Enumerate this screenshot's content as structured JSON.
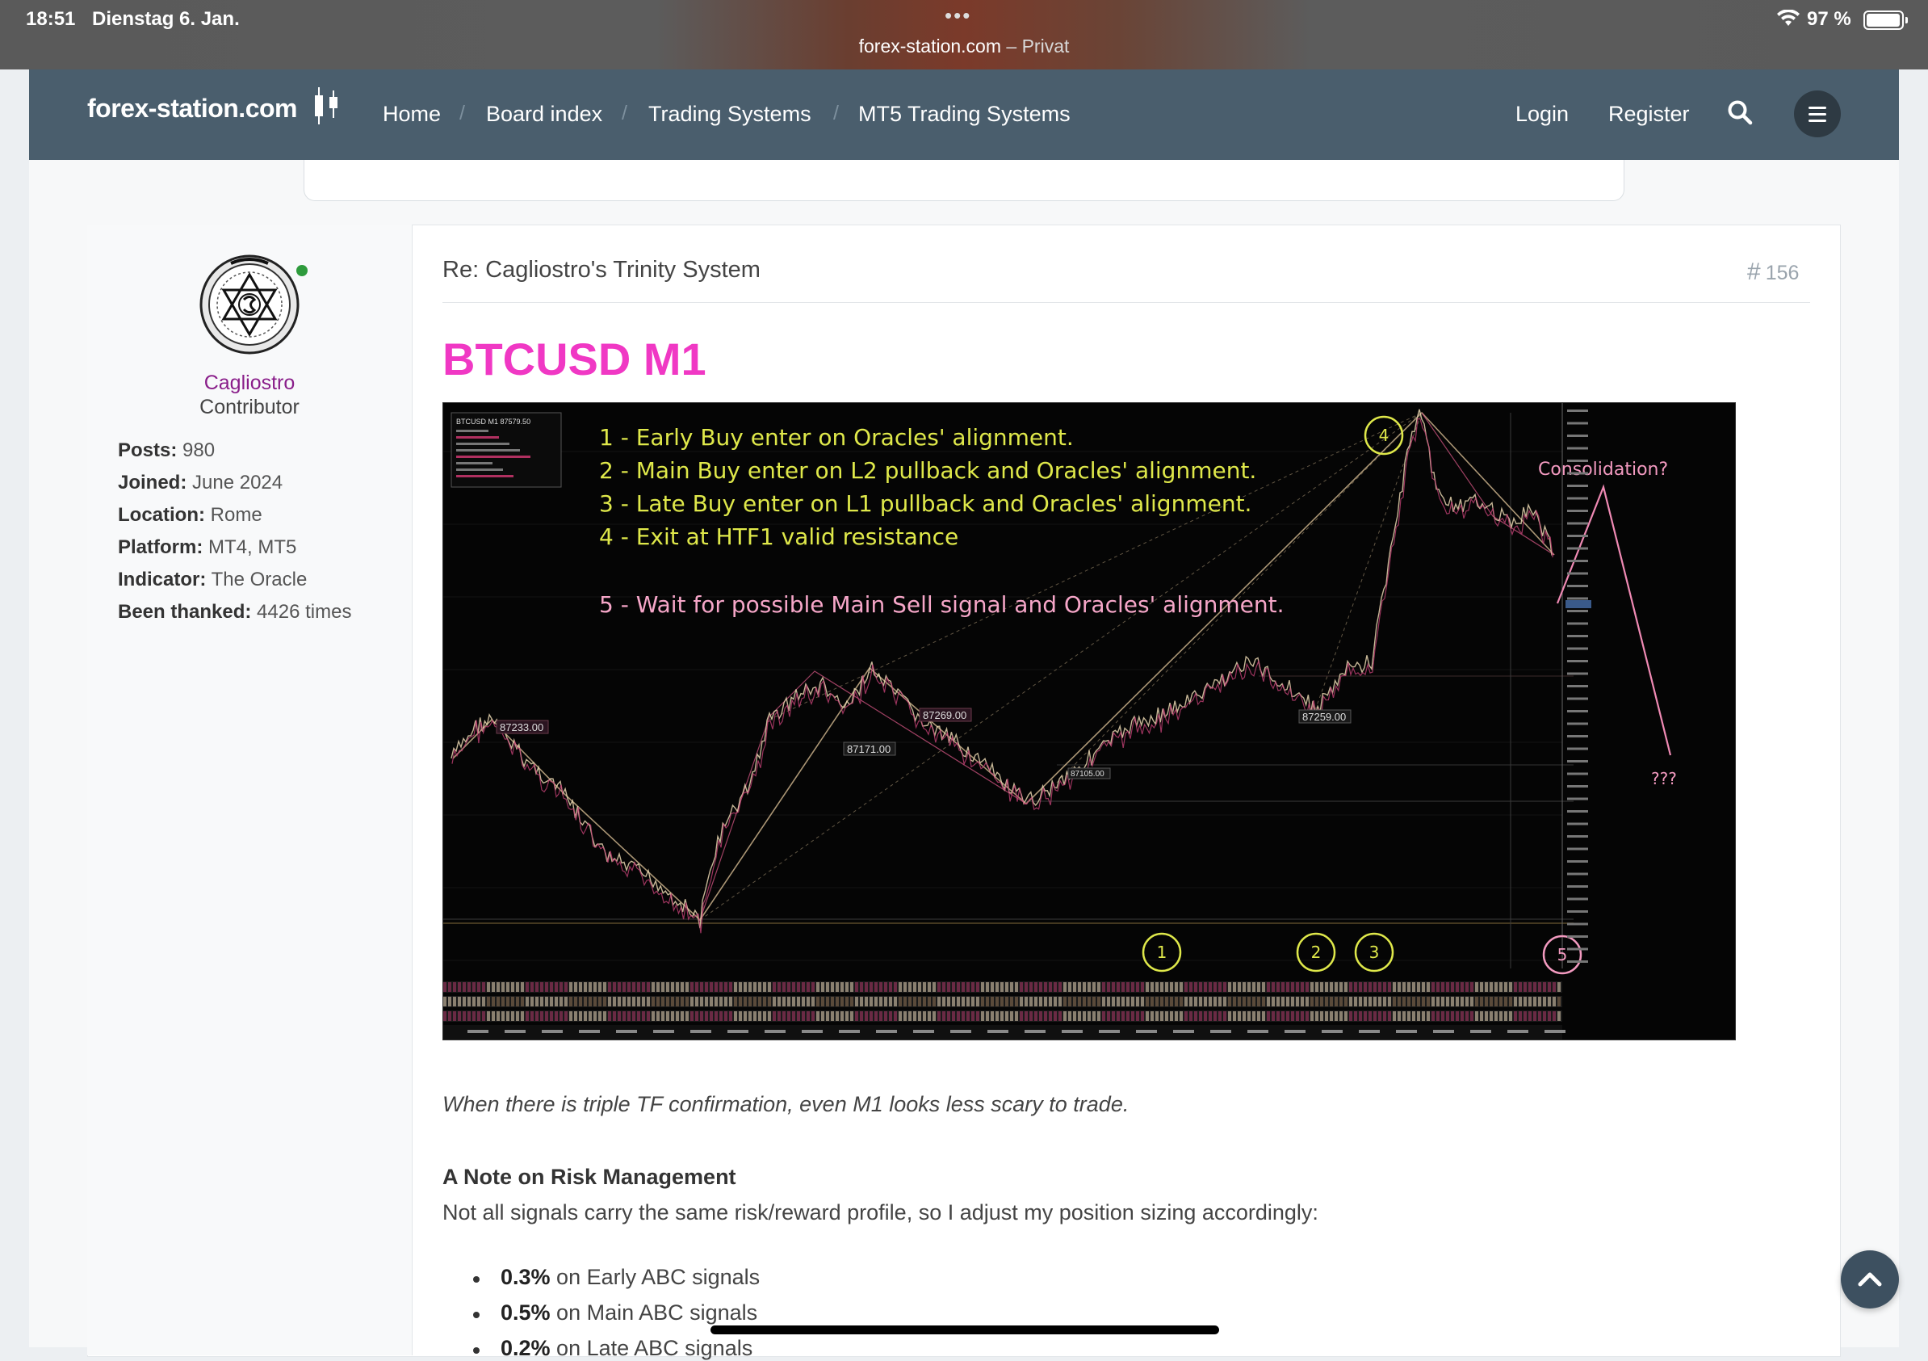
{
  "status_bar": {
    "time": "18:51",
    "date": "Dienstag 6. Jan.",
    "url": "forex-station.com",
    "mode": " – Privat",
    "battery": "97 %"
  },
  "nav": {
    "logo": "forex-station.com",
    "links": [
      "Home",
      "Board index",
      "Trading Systems",
      "MT5 Trading Systems"
    ],
    "login": "Login",
    "register": "Register",
    "color": "#4a5e6d"
  },
  "author": {
    "name": "Cagliostro",
    "rank": "Contributor",
    "stats": [
      {
        "label": "Posts:",
        "value": " 980"
      },
      {
        "label": "Joined:",
        "value": " June 2024"
      },
      {
        "label": "Location:",
        "value": " Rome"
      },
      {
        "label": "Platform:",
        "value": " MT4, MT5"
      },
      {
        "label": "Indicator:",
        "value": " The Oracle"
      },
      {
        "label": "Been thanked:",
        "value": " 4426 times"
      }
    ]
  },
  "post": {
    "title": "Re: Cagliostro's Trinity System",
    "number": "156",
    "headline": "BTCUSD M1",
    "headline_color": "#f038c4",
    "caption": "When there is triple TF confirmation, even M1 looks less scary to trade.",
    "note_heading": "A Note on Risk Management",
    "note_text": "Not all signals carry the same risk/reward profile, so I adjust my position sizing accordingly:",
    "bullets": [
      {
        "value": "0.3%",
        "text": " on Early ABC signals"
      },
      {
        "value": "0.5%",
        "text": " on Main ABC signals"
      },
      {
        "value": "0.2%",
        "text": " on Late ABC signals"
      }
    ]
  },
  "chart_image": {
    "symbol": "BTCUSD M1",
    "info_price": "87579.50",
    "instructions": [
      "1 - Early Buy enter on Oracles' alignment.",
      "2 - Main Buy enter on L2 pullback and Oracles' alignment.",
      "3 - Late Buy enter on L1 pullback and Oracles' alignment.",
      "4 - Exit at HTF1 valid resistance",
      "5 - Wait for possible Main Sell signal and Oracles' alignment."
    ],
    "consolidation": "Consolidation?",
    "question": "???",
    "price_labels": [
      "87233.00",
      "87171.00",
      "87269.00",
      "87259.00",
      "87105.00"
    ],
    "circles": [
      "1",
      "2",
      "3",
      "4",
      "5"
    ],
    "instruction_color": "#dfe84a",
    "pink": "#e05a8a"
  }
}
